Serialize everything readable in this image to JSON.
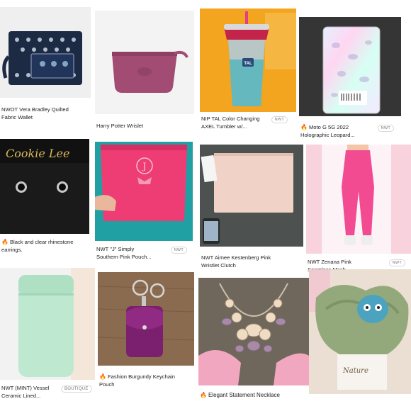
{
  "colors": {
    "flame": "#e8702a",
    "caption": "#222222",
    "badge_border": "#d8d8d8"
  },
  "items": [
    {
      "title_line1": "NWOT Vera Bradley Quilted",
      "title_line2": "Fabric Wallet",
      "badge": "",
      "flame": false
    },
    {
      "title_line1": "Harry Potter Wrislet",
      "title_line2": "",
      "badge": "",
      "flame": false
    },
    {
      "title_line1": "NIP TAL Color Changing",
      "title_line2": "AXEL Tumbler w/...",
      "badge": "NWT",
      "flame": false
    },
    {
      "title_line1": "Moto G 5G 2022",
      "title_line2": "Holographic Leopard...",
      "badge": "NWT",
      "flame": true
    },
    {
      "title_line1": "Black and clear rhinestone",
      "title_line2": "earrings.",
      "badge": "",
      "flame": true
    },
    {
      "title_line1": "NWT \"J\" Simply",
      "title_line2": "Southern Pink Pouch...",
      "badge": "NWT",
      "flame": false
    },
    {
      "title_line1": "NWT Aimee Kestenberg Pink",
      "title_line2": "Wristlet Clutch",
      "badge": "",
      "flame": false
    },
    {
      "title_line1": "NWT Zenana Pink",
      "title_line2": "Seamless Mesh...",
      "badge": "NWT",
      "flame": false
    },
    {
      "title_line1": "NWT (MINT) Vessel",
      "title_line2": "Ceramic Lined...",
      "badge": "BOUTIQUE",
      "flame": false
    },
    {
      "title_line1": "Fashion Burgundy Keychain",
      "title_line2": "Pouch",
      "badge": "",
      "flame": true
    },
    {
      "title_line1": "Elegant Statement Necklace",
      "title_line2": "",
      "badge": "",
      "flame": true
    },
    {
      "title_line1": "",
      "title_line2": "",
      "badge": "",
      "flame": false
    }
  ],
  "image_text": {
    "cookie_lee": "Cookie Lee",
    "tal": "TAL",
    "nature": "Nature"
  }
}
